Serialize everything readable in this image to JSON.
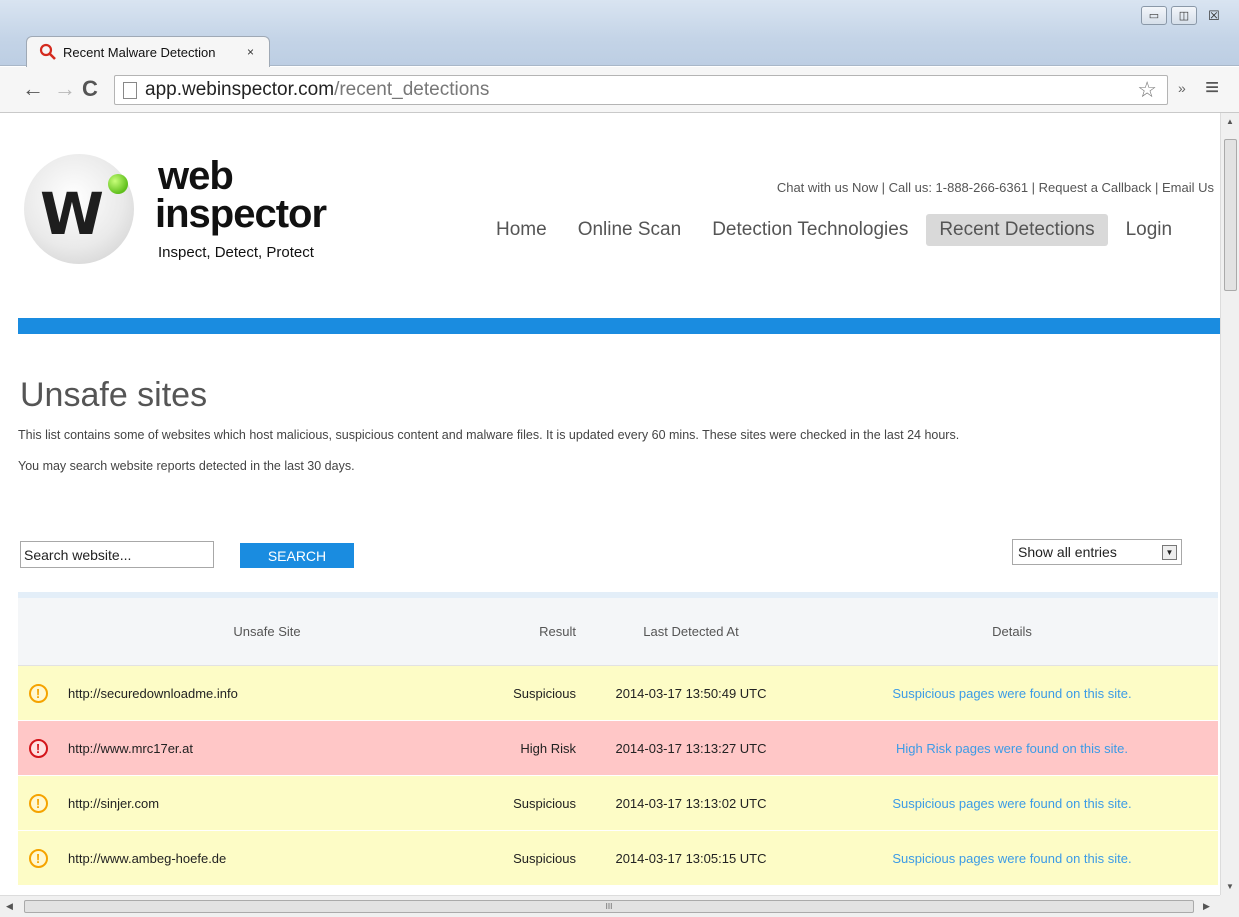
{
  "browser": {
    "tab_title": "Recent Malware Detection",
    "tab_close": "×",
    "url_host": "app.webinspector.com",
    "url_path": "/recent_detections",
    "window_controls": {
      "minimize": "▭",
      "maximize": "◫",
      "close": "☒"
    },
    "icons": {
      "back": "←",
      "forward": "→",
      "reload": "C",
      "star": "☆",
      "extensions": "»",
      "menu": "≡"
    }
  },
  "header": {
    "logo_word1": "web",
    "logo_word2": "inspector",
    "logo_letter": "W",
    "tagline": "Inspect, Detect, Protect",
    "contact": "Chat with us Now | Call us: 1-888-266-6361 | Request a Callback | Email Us",
    "nav": [
      "Home",
      "Online Scan",
      "Detection Technologies",
      "Recent Detections",
      "Login"
    ],
    "active_nav": "Recent Detections"
  },
  "content": {
    "title": "Unsafe sites",
    "description1": "This list contains some of websites which host malicious, suspicious content and malware files. It is updated every 60 mins. These sites were checked in the last 24 hours.",
    "description2": "You may search website reports detected in the last 30 days.",
    "search_value": "Search website...",
    "search_button": "SEARCH",
    "entries_select": "Show all entries"
  },
  "table": {
    "headers": [
      "Unsafe Site",
      "Result",
      "Last Detected At",
      "Details"
    ],
    "rows": [
      {
        "site": "http://securedownloadme.info",
        "result": "Suspicious",
        "date": "2014-03-17 13:50:49 UTC",
        "details": "Suspicious pages were found on this site."
      },
      {
        "site": "http://www.mrc17er.at",
        "result": "High Risk",
        "date": "2014-03-17 13:13:27 UTC",
        "details": "High Risk pages were found on this site."
      },
      {
        "site": "http://sinjer.com",
        "result": "Suspicious",
        "date": "2014-03-17 13:13:02 UTC",
        "details": "Suspicious pages were found on this site."
      },
      {
        "site": "http://www.ambeg-hoefe.de",
        "result": "Suspicious",
        "date": "2014-03-17 13:05:15 UTC",
        "details": "Suspicious pages were found on this site."
      }
    ]
  },
  "colors": {
    "accent_blue": "#1a8ce0",
    "suspicious_row": "#fdfcc6",
    "high_risk_row": "#ffc7c7",
    "suspicious_icon": "#f5a300",
    "high_risk_icon": "#d3151b",
    "link": "#3c9be6"
  }
}
